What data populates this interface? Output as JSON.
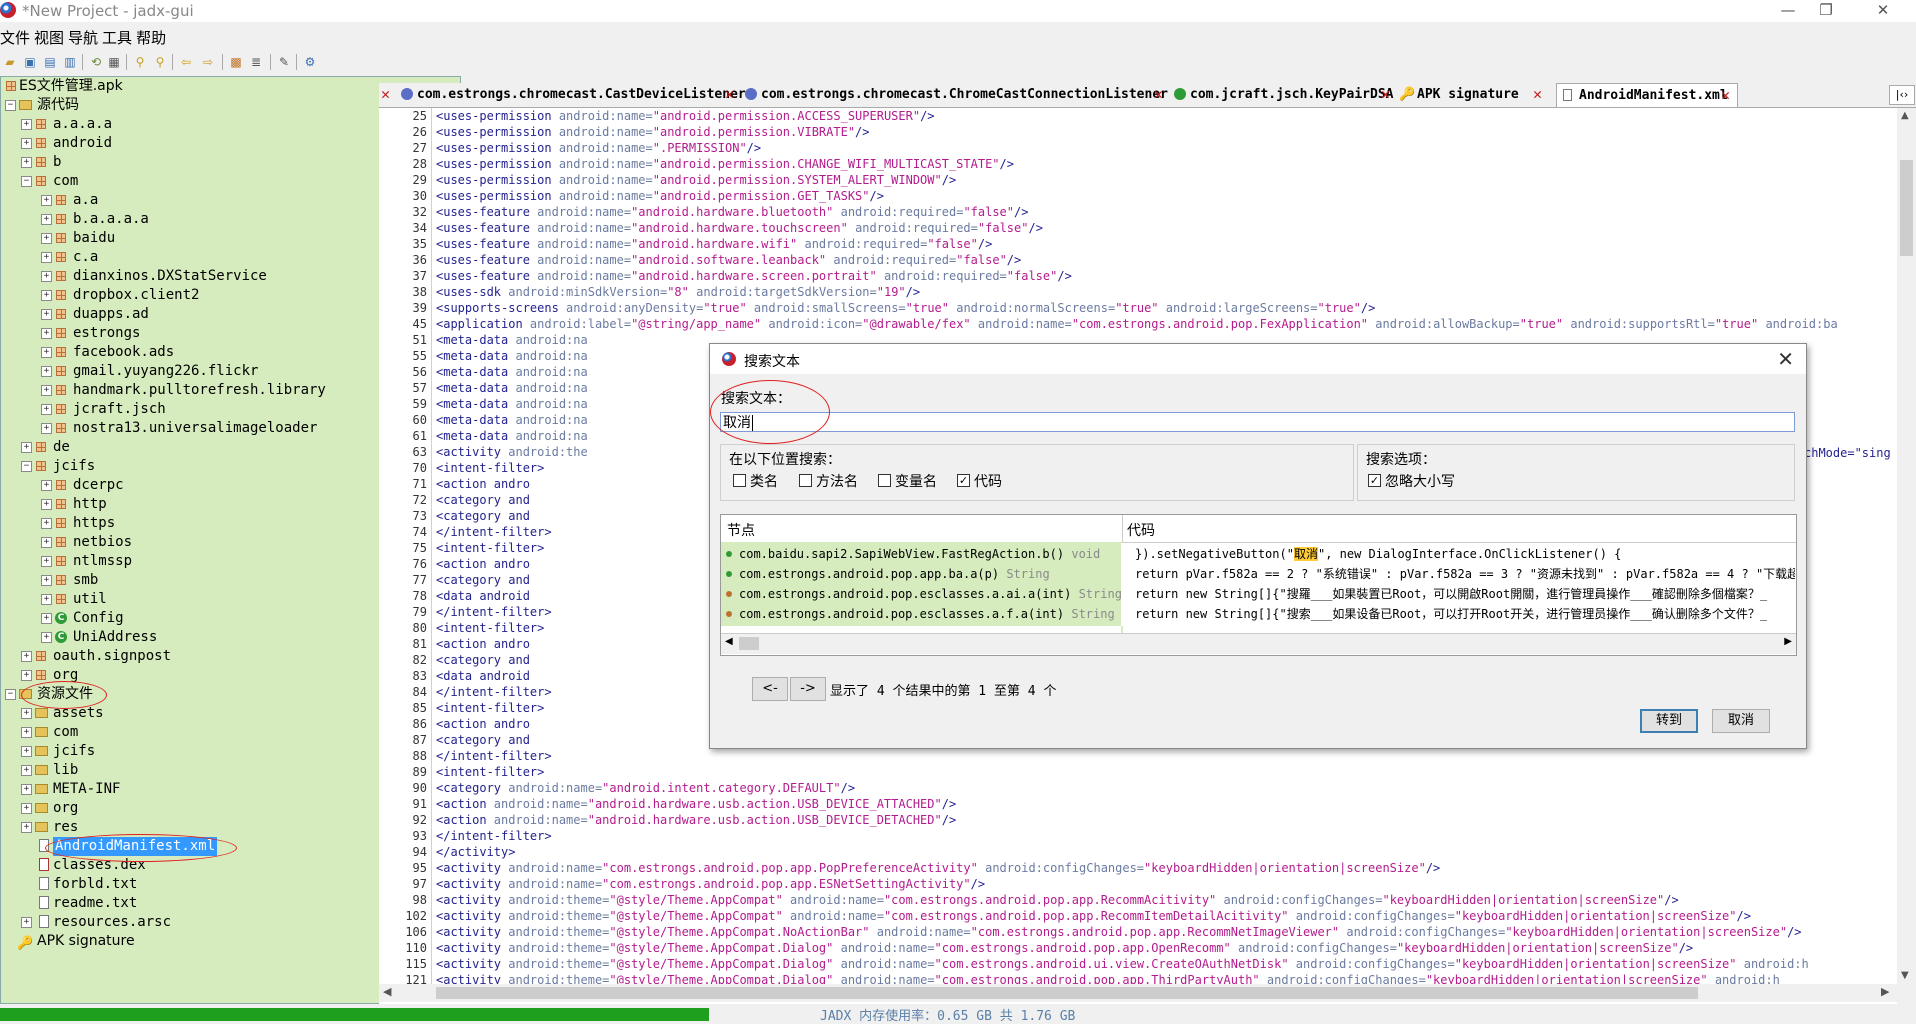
{
  "window": {
    "title": "*New Project - jadx-gui",
    "minimize": "—",
    "restore": "❐",
    "close": "✕"
  },
  "menu": [
    "文件",
    "视图",
    "导航",
    "工具",
    "帮助"
  ],
  "tree": {
    "root": "ES文件管理.apk",
    "source_label": "源代码",
    "packages": [
      "a.a.a.a",
      "android",
      "b",
      "com",
      "a.a",
      "b.a.a.a.a",
      "baidu",
      "c.a",
      "dianxinos.DXStatService",
      "dropbox.client2",
      "duapps.ad",
      "estrongs",
      "facebook.ads",
      "gmail.yuyang226.flickr",
      "handmark.pulltorefresh.library",
      "jcraft.jsch",
      "nostra13.universalimageloader",
      "de",
      "jcifs",
      "dcerpc",
      "http",
      "https",
      "netbios",
      "ntlmssp",
      "smb",
      "util",
      "Config",
      "UniAddress",
      "oauth.signpost",
      "org"
    ],
    "resources_label": "资源文件",
    "resources": [
      "assets",
      "com",
      "jcifs",
      "lib",
      "META-INF",
      "org",
      "res",
      "AndroidManifest.xml",
      "classes.dex",
      "forbld.txt",
      "readme.txt",
      "resources.arsc"
    ],
    "apk_signature": "APK signature"
  },
  "tabs": [
    {
      "label": "com.estrongs.chromecast.CastDeviceListener"
    },
    {
      "label": "com.estrongs.chromecast.ChromeCastConnectionListener"
    },
    {
      "label": "com.jcraft.jsch.KeyPairDSA"
    },
    {
      "label": "APK signature"
    },
    {
      "label": "AndroidManifest.xml"
    }
  ],
  "editor": {
    "line_numbers": [
      "25",
      "26",
      "27",
      "28",
      "29",
      "30",
      "32",
      "34",
      "35",
      "36",
      "37",
      "38",
      "39",
      "45",
      "51",
      "55",
      "56",
      "57",
      "59",
      "60",
      "61",
      "63",
      "70",
      "71",
      "72",
      "73",
      "74",
      "75",
      "76",
      "77",
      "78",
      "79",
      "80",
      "81",
      "82",
      "83",
      "84",
      "85",
      "86",
      "87",
      "88",
      "89",
      "90",
      "91",
      "92",
      "93",
      "94",
      "95",
      "97",
      "98",
      "102",
      "106",
      "110",
      "115",
      "121"
    ],
    "lines": [
      "<uses-permission android:name=\"android.permission.ACCESS_SUPERUSER\"/>",
      "<uses-permission android:name=\"android.permission.VIBRATE\"/>",
      "<uses-permission android:name=\".PERMISSION\"/>",
      "<uses-permission android:name=\"android.permission.CHANGE_WIFI_MULTICAST_STATE\"/>",
      "<uses-permission android:name=\"android.permission.SYSTEM_ALERT_WINDOW\"/>",
      "<uses-permission android:name=\"android.permission.GET_TASKS\"/>",
      "<uses-feature android:name=\"android.hardware.bluetooth\" android:required=\"false\"/>",
      "<uses-feature android:name=\"android.hardware.touchscreen\" android:required=\"false\"/>",
      "<uses-feature android:name=\"android.hardware.wifi\" android:required=\"false\"/>",
      "<uses-feature android:name=\"android.software.leanback\" android:required=\"false\"/>",
      "<uses-feature android:name=\"android.hardware.screen.portrait\" android:required=\"false\"/>",
      "<uses-sdk android:minSdkVersion=\"8\" android:targetSdkVersion=\"19\"/>",
      "<supports-screens android:anyDensity=\"true\" android:smallScreens=\"true\" android:normalScreens=\"true\" android:largeScreens=\"true\"/>",
      "<application android:label=\"@string/app_name\" android:icon=\"@drawable/fex\" android:name=\"com.estrongs.android.pop.FexApplication\" android:allowBackup=\"true\" android:supportsRtl=\"true\" android:ba",
      "    <meta-data android:na",
      "    <meta-data android:na",
      "    <meta-data android:na",
      "    <meta-data android:na",
      "    <meta-data android:na",
      "    <meta-data android:na",
      "    <meta-data android:na",
      "    <activity android:the",
      "        <intent-filter>",
      "            <action andro",
      "            <category and",
      "            <category and",
      "        </intent-filter>",
      "        <intent-filter>",
      "            <action andro",
      "            <category and",
      "            <data android",
      "        </intent-filter>",
      "        <intent-filter>",
      "            <action andro",
      "            <category and",
      "            <data android",
      "        </intent-filter>",
      "        <intent-filter>",
      "            <action andro",
      "            <category and",
      "        </intent-filter>",
      "        <intent-filter>",
      "            <category android:name=\"android.intent.category.DEFAULT\"/>",
      "            <action android:name=\"android.hardware.usb.action.USB_DEVICE_ATTACHED\"/>",
      "            <action android:name=\"android.hardware.usb.action.USB_DEVICE_DETACHED\"/>",
      "        </intent-filter>",
      "    </activity>",
      "    <activity android:name=\"com.estrongs.android.pop.app.PopPreferenceActivity\" android:configChanges=\"keyboardHidden|orientation|screenSize\"/>",
      "    <activity android:name=\"com.estrongs.android.pop.app.ESNetSettingActivity\"/>",
      "    <activity android:theme=\"@style/Theme.AppCompat\" android:name=\"com.estrongs.android.pop.app.RecommAcitivity\" android:configChanges=\"keyboardHidden|orientation|screenSize\"/>",
      "    <activity android:theme=\"@style/Theme.AppCompat\" android:name=\"com.estrongs.android.pop.app.RecommItemDetailAcitivity\" android:configChanges=\"keyboardHidden|orientation|screenSize\"/>",
      "    <activity android:theme=\"@style/Theme.AppCompat.NoActionBar\" android:name=\"com.estrongs.android.pop.app.RecommNetImageViewer\" android:configChanges=\"keyboardHidden|orientation|screenSize\"/>",
      "    <activity android:theme=\"@style/Theme.AppCompat.Dialog\" android:name=\"com.estrongs.android.pop.app.OpenRecomm\" android:configChanges=\"keyboardHidden|orientation|screenSize\"/>",
      "    <activity android:theme=\"@style/Theme.AppCompat.Dialog\" android:name=\"com.estrongs.android.ui.view.CreateOAuthNetDisk\" android:configChanges=\"keyboardHidden|orientation|screenSize\" android:h",
      "    <activity android:theme=\"@style/Theme.AppCompat.Dialog\" android:name=\"com.estrongs.android.pop.app.ThirdPartyAuth\" android:configChanges=\"keyboardHidden|orientation|screenSize\" android:h"
    ],
    "right_overflow_fragment": "chMode=\"sing"
  },
  "dialog": {
    "title": "搜索文本",
    "search_label": "搜索文本：",
    "search_value": "取消",
    "scope_label": "在以下位置搜索：",
    "scope_options": [
      {
        "label": "类名",
        "checked": false
      },
      {
        "label": "方法名",
        "checked": false
      },
      {
        "label": "变量名",
        "checked": false
      },
      {
        "label": "代码",
        "checked": true
      }
    ],
    "options_label": "搜索选项：",
    "ignore_case": {
      "label": "忽略大小写",
      "checked": true
    },
    "results": {
      "header_node": "节点",
      "header_code": "代码",
      "rows": [
        {
          "node": "com.baidu.sapi2.SapiWebView.FastRegAction.b()",
          "type": "void",
          "code_pre": "}).setNegativeButton(\"",
          "code_hl": "取消",
          "code_post": "\", new DialogInterface.OnClickListener() {"
        },
        {
          "node": "com.estrongs.android.pop.app.ba.a(p)",
          "type": "String",
          "code": "return pVar.f582a == 2 ? \"系统错误\" : pVar.f582a == 3 ? \"资源未找到\" : pVar.f582a == 4 ? \"下载超"
        },
        {
          "node": "com.estrongs.android.pop.esclasses.a.ai.a(int)",
          "type": "String",
          "code": "return new String[]{\"搜羅___如果裝置已Root，可以開啟Root開關，進行管理員操作___確認刪除多個檔案？_"
        },
        {
          "node": "com.estrongs.android.pop.esclasses.a.f.a(int)",
          "type": "String",
          "code": "return new String[]{\"搜索___如果设备已Root，可以打开Root开关，进行管理员操作___确认删除多个文件？_"
        }
      ]
    },
    "prev": "<-",
    "next": "->",
    "result_info": "显示了 4 个结果中的第 1 至第 4 个",
    "goto": "转到",
    "cancel": "取消"
  },
  "status": {
    "memory": "JADX 内存使用率：0.65 GB 共 1.76 GB",
    "memory_fraction": 0.37
  }
}
